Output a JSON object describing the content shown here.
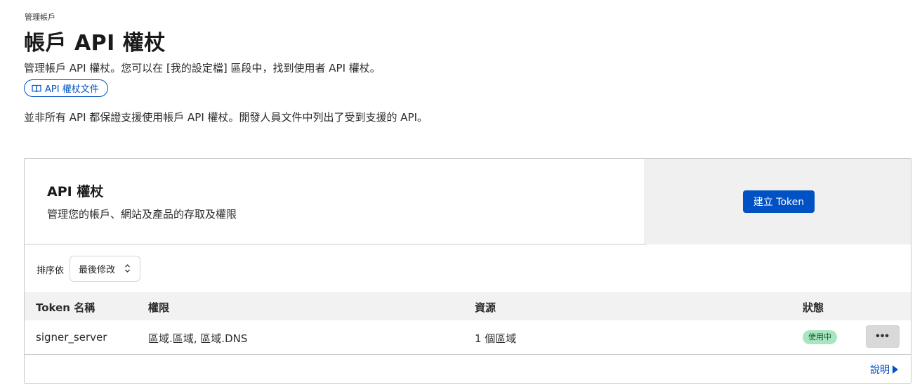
{
  "breadcrumb": "管理帳戶",
  "page": {
    "title": "帳戶 API 權杖",
    "description": "管理帳戶 API 權杖。您可以在 [我的設定檔] 區段中，找到使用者 API 權杖。",
    "docs_link": "API 權杖文件",
    "note": "並非所有 API 都保證支援使用帳戶 API 權杖。開發人員文件中列出了受到支援的 API。"
  },
  "card": {
    "title": "API 權杖",
    "subtitle": "管理您的帳戶、網站及產品的存取及權限",
    "create_button": "建立 Token",
    "sort_label": "排序依",
    "sort_value": "最後修改",
    "columns": {
      "name": "Token 名稱",
      "permissions": "權限",
      "resources": "資源",
      "status": "狀態"
    },
    "rows": [
      {
        "name": "signer_server",
        "permissions": "區域.區域, 區域.DNS",
        "resources": "1 個區域",
        "status": "使用中",
        "more": "•••"
      }
    ],
    "help_link": "說明"
  },
  "colors": {
    "accent": "#0051c3",
    "status_active_bg": "#a8e6c1",
    "header_bg": "#f2f2f2"
  },
  "icons": {
    "docs": "book-icon",
    "sort": "chevron-up-down-icon",
    "help": "triangle-right-icon"
  }
}
